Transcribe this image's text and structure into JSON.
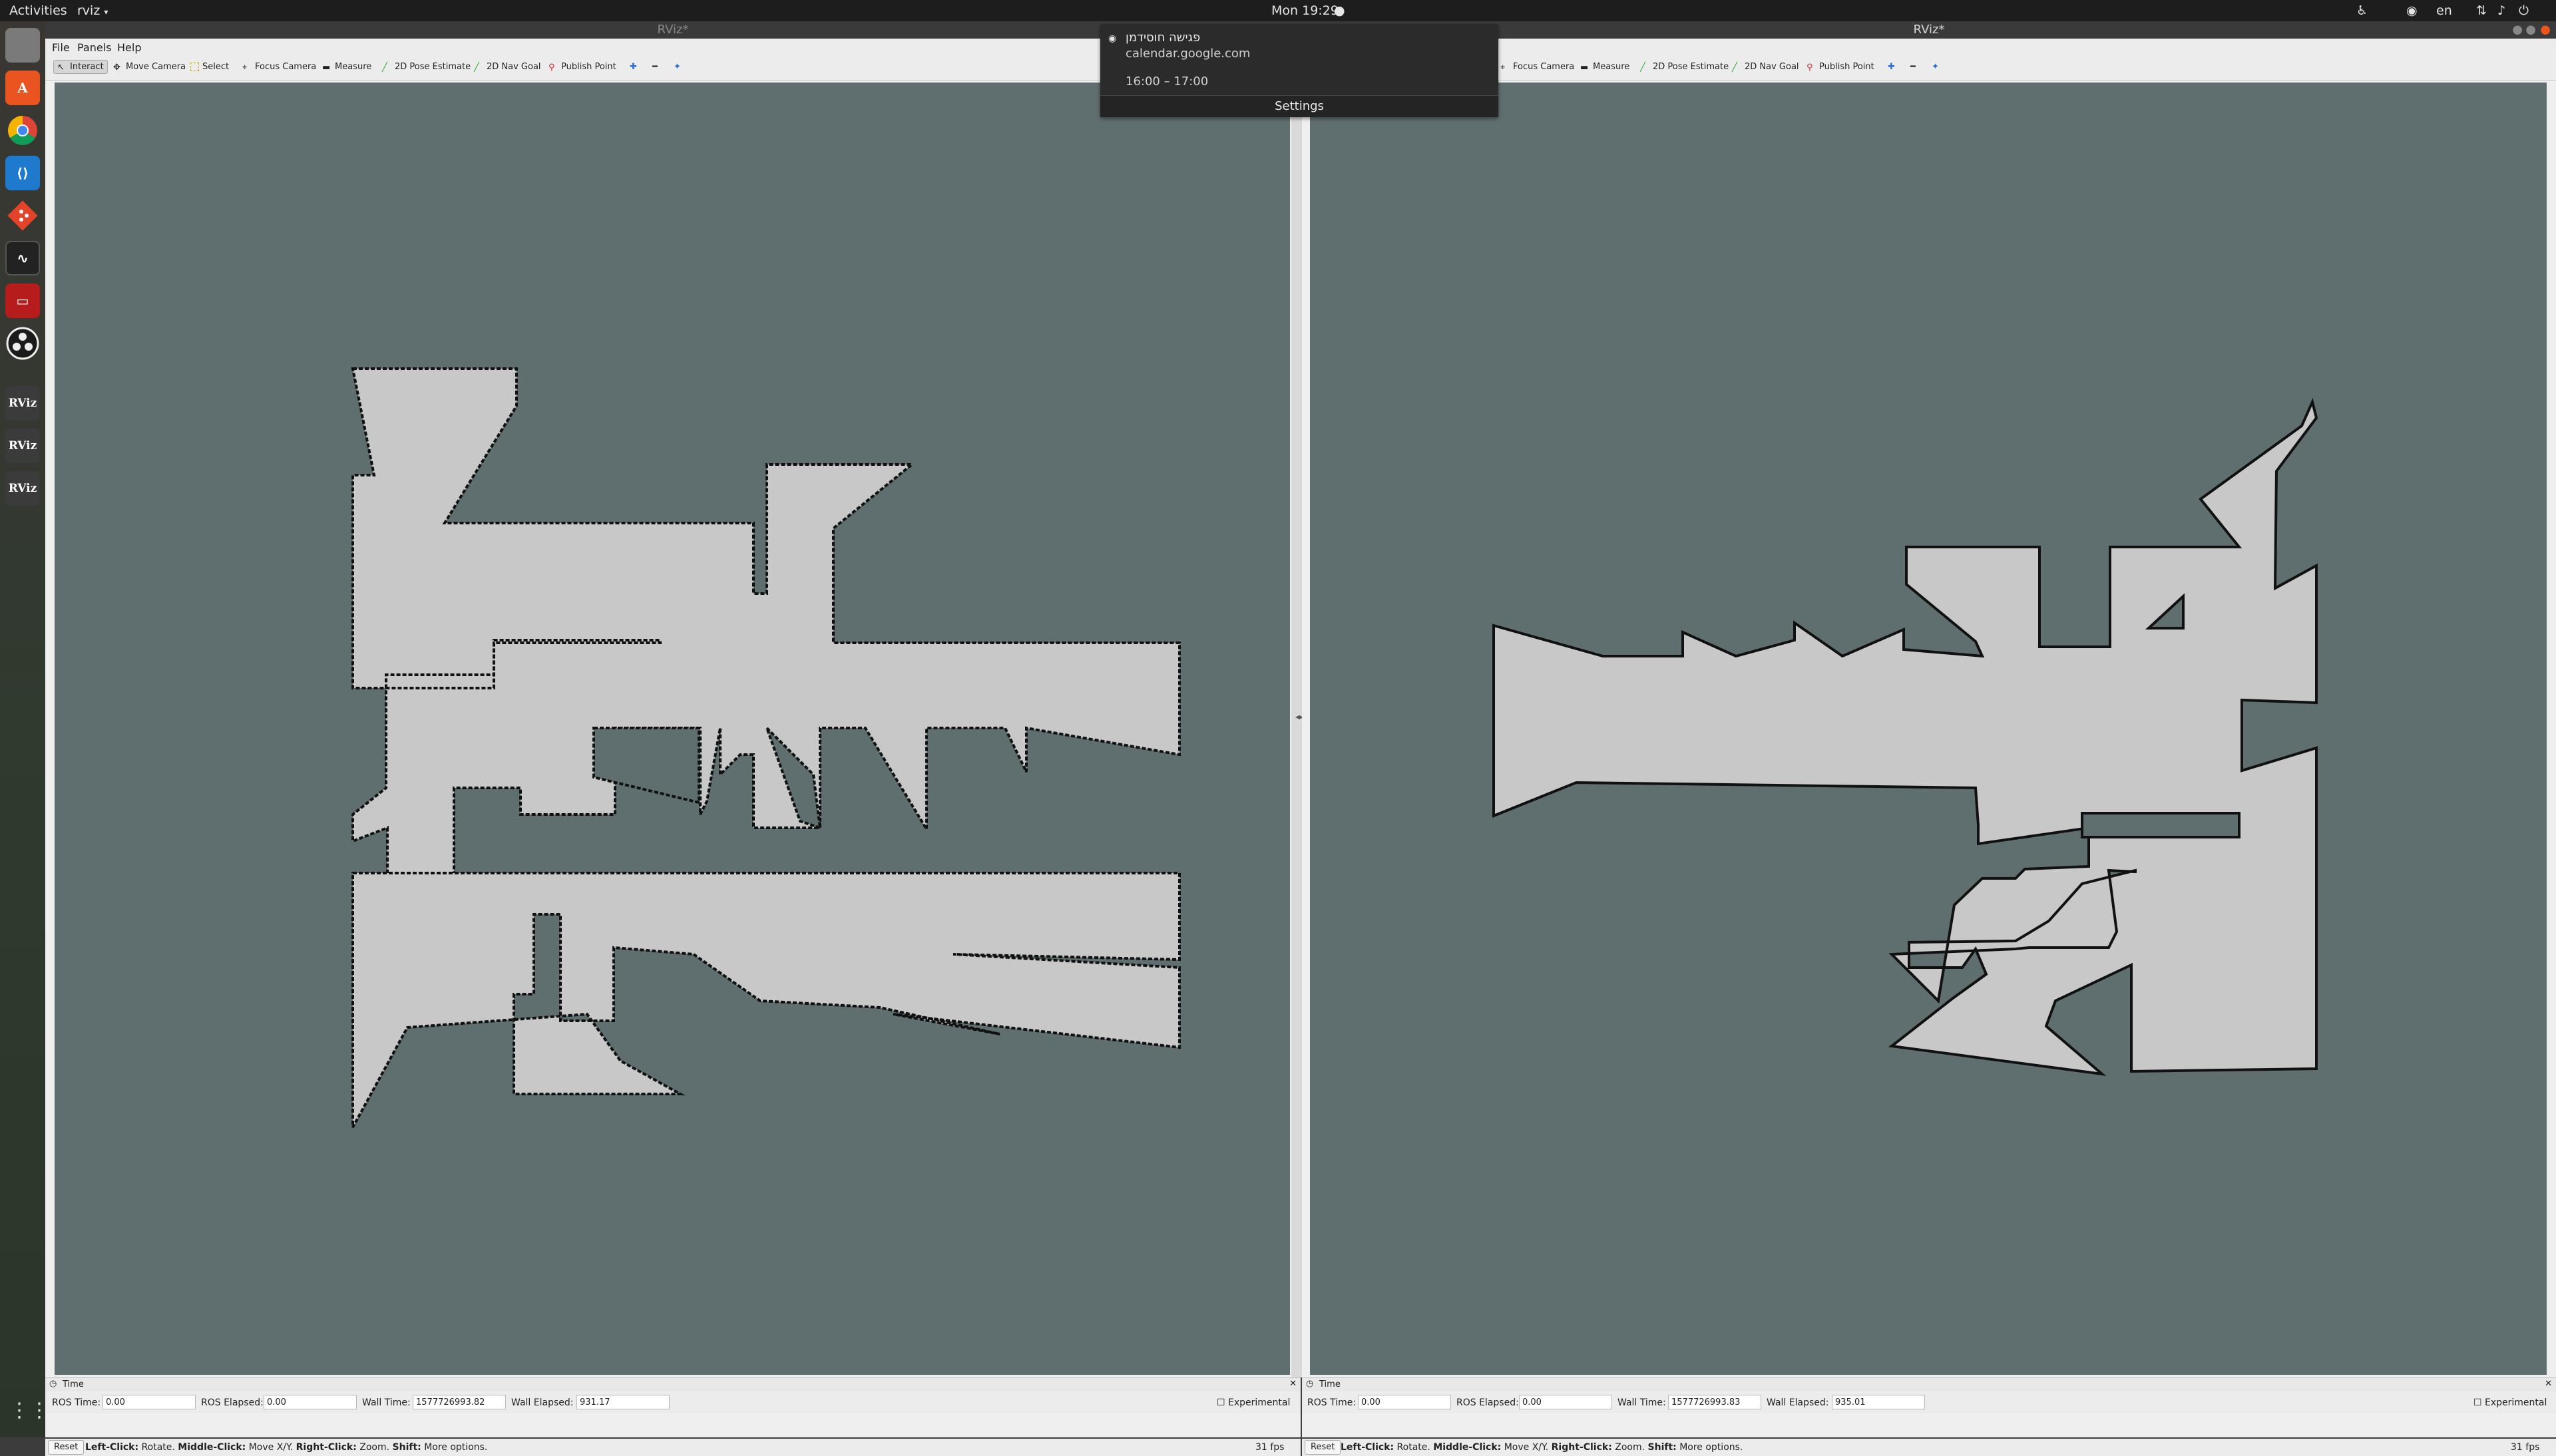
{
  "top_bar": {
    "activities": "Activities",
    "app_menu": "rviz",
    "clock": "Mon 19:29",
    "language": "en"
  },
  "dock": {
    "apps": [
      {
        "label": "",
        "icon": "files-icon",
        "color": "#7a7a7a"
      },
      {
        "label": "A",
        "icon": "software-center-icon",
        "color": "#e95420"
      },
      {
        "label": "",
        "icon": "chrome-icon",
        "color": "#f2f2f2"
      },
      {
        "label": "",
        "icon": "vscode-icon",
        "color": "#1f7acd"
      },
      {
        "label": "",
        "icon": "git-icon",
        "color": "#e24329"
      },
      {
        "label": "",
        "icon": "system-monitor-icon",
        "color": "#222222"
      },
      {
        "label": "",
        "icon": "terminal-red-icon",
        "color": "#b71c1c"
      },
      {
        "label": "",
        "icon": "obs-icon",
        "color": "#1b1b1b"
      },
      {
        "label": "RViz",
        "icon": "rviz-icon",
        "color": "#3b3b3b"
      },
      {
        "label": "RViz",
        "icon": "rviz-icon",
        "color": "#3b3b3b"
      },
      {
        "label": "RViz",
        "icon": "rviz-icon",
        "color": "#3b3b3b"
      }
    ]
  },
  "notification": {
    "title": "פגישה חוסידמן",
    "source": "calendar.google.com",
    "time": "16:00 – 17:00",
    "settings": "Settings"
  },
  "left_window": {
    "title": "RViz*",
    "menu": {
      "file": "File",
      "panels": "Panels",
      "help": "Help"
    },
    "tools": {
      "interact": "Interact",
      "move_camera": "Move Camera",
      "select": "Select",
      "focus_camera": "Focus Camera",
      "measure": "Measure",
      "pose_estimate": "2D Pose Estimate",
      "nav_goal": "2D Nav Goal",
      "publish_point": "Publish Point"
    },
    "time_panel_title": "Time",
    "ros_time_label": "ROS Time:",
    "ros_time": "0.00",
    "ros_elapsed_label": "ROS Elapsed:",
    "ros_elapsed": "0.00",
    "wall_time_label": "Wall Time:",
    "wall_time": "1577726993.82",
    "wall_elapsed_label": "Wall Elapsed:",
    "wall_elapsed": "931.17",
    "experimental": "Experimental",
    "reset": "Reset",
    "hint_left_click": "Left-Click:",
    "hint_rotate": "Rotate.",
    "hint_middle_click": "Middle-Click:",
    "hint_move": "Move X/Y.",
    "hint_right_click": "Right-Click:",
    "hint_zoom": "Zoom.",
    "hint_shift": "Shift:",
    "hint_more": "More options.",
    "fps": "31 fps"
  },
  "right_window": {
    "title": "RViz*",
    "tools": {
      "focus_camera": "Focus Camera",
      "measure": "Measure",
      "pose_estimate": "2D Pose Estimate",
      "nav_goal": "2D Nav Goal",
      "publish_point": "Publish Point"
    },
    "time_panel_title": "Time",
    "ros_time_label": "ROS Time:",
    "ros_time": "0.00",
    "ros_elapsed_label": "ROS Elapsed:",
    "ros_elapsed": "0.00",
    "wall_time_label": "Wall Time:",
    "wall_time": "1577726993.83",
    "wall_elapsed_label": "Wall Elapsed:",
    "wall_elapsed": "935.01",
    "experimental": "Experimental",
    "reset": "Reset",
    "hint_left_click": "Left-Click:",
    "hint_rotate": "Rotate.",
    "hint_middle_click": "Middle-Click:",
    "hint_move": "Move X/Y.",
    "hint_right_click": "Right-Click:",
    "hint_zoom": "Zoom.",
    "hint_shift": "Shift:",
    "hint_more": "More options.",
    "fps": "31 fps"
  },
  "colors": {
    "map_background": "#5f6e6e",
    "free_space": "#c8c8c8",
    "obstacle": "#111111"
  }
}
